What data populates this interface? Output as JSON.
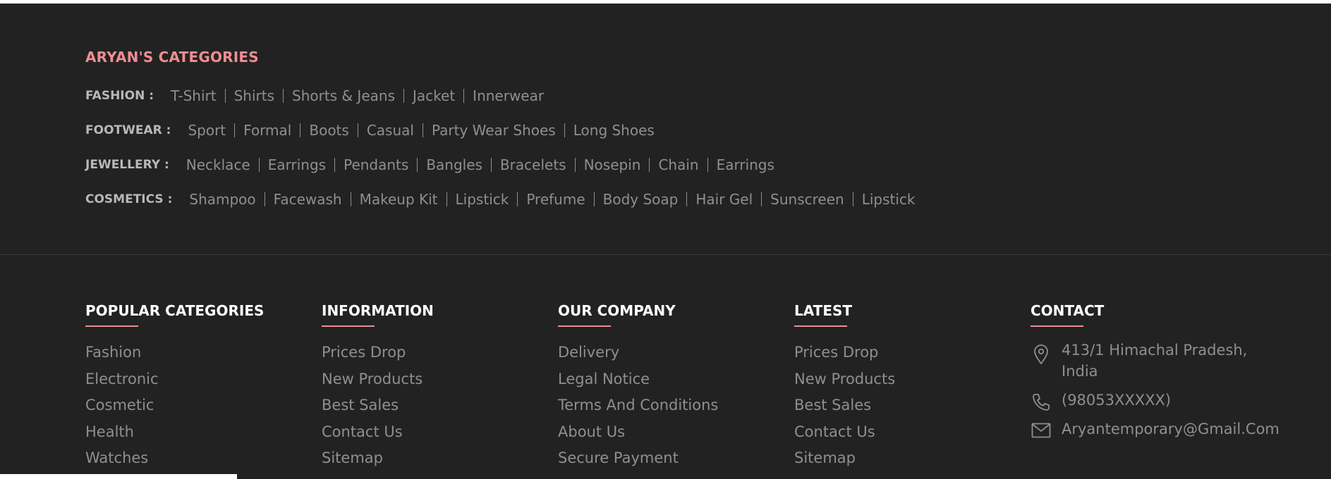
{
  "categories": {
    "title": "ARYAN'S CATEGORIES",
    "rows": [
      {
        "label": "FASHION :",
        "items": [
          "T-Shirt",
          "Shirts",
          "Shorts & Jeans",
          "Jacket",
          "Innerwear"
        ]
      },
      {
        "label": "FOOTWEAR :",
        "items": [
          "Sport",
          "Formal",
          "Boots",
          "Casual",
          "Party Wear Shoes",
          "Long Shoes"
        ]
      },
      {
        "label": "JEWELLERY :",
        "items": [
          "Necklace",
          "Earrings",
          "Pendants",
          "Bangles",
          "Bracelets",
          "Nosepin",
          "Chain",
          "Earrings"
        ]
      },
      {
        "label": "COSMETICS :",
        "items": [
          "Shampoo",
          "Facewash",
          "Makeup Kit",
          "Lipstick",
          "Prefume",
          "Body Soap",
          "Hair Gel",
          "Sunscreen",
          "Lipstick"
        ]
      }
    ]
  },
  "columns": [
    {
      "title": "POPULAR CATEGORIES",
      "items": [
        "Fashion",
        "Electronic",
        "Cosmetic",
        "Health",
        "Watches"
      ]
    },
    {
      "title": "INFORMATION",
      "items": [
        "Prices Drop",
        "New Products",
        "Best Sales",
        "Contact Us",
        "Sitemap"
      ]
    },
    {
      "title": "OUR COMPANY",
      "items": [
        "Delivery",
        "Legal Notice",
        "Terms And Conditions",
        "About Us",
        "Secure Payment"
      ]
    },
    {
      "title": "LATEST",
      "items": [
        "Prices Drop",
        "New Products",
        "Best Sales",
        "Contact Us",
        "Sitemap"
      ]
    }
  ],
  "contact": {
    "title": "CONTACT",
    "address_line1": "413/1 Himachal Pradesh,",
    "address_line2": "India",
    "phone": "(98053XXXXX)",
    "email": "Aryantemporary@Gmail.Com"
  },
  "colors": {
    "background": "#222222",
    "accent": "#f08c92",
    "heading": "#ffffff",
    "link": "#8f8f8f"
  }
}
